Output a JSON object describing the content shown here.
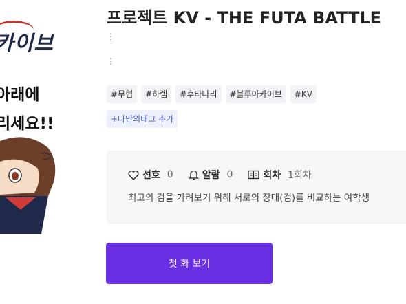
{
  "cover": {
    "logo_text": "카이브",
    "line1": "아래에",
    "line2": "리세요!!"
  },
  "work": {
    "title": "프로젝트 KV - THE FUTA BATTLE",
    "meta1": "⋮",
    "meta2": "⋮"
  },
  "tags": [
    "#무협",
    "#하렘",
    "#후타나리",
    "#블루아카이브",
    "#KV"
  ],
  "add_tag_label": "+나만의태그 추가",
  "stats": {
    "favorite_label": "선호",
    "favorite_value": "0",
    "alarm_label": "알람",
    "alarm_value": "0",
    "episodes_label": "회차",
    "episodes_value": "1회차"
  },
  "description": "최고의 검을 가려보기 위해 서로의 장대(검)를 비교하는 여학생",
  "first_episode_button": "첫 화 보기",
  "colors": {
    "accent": "#6a2fe3",
    "tag_bg": "#f2f3f6",
    "add_tag_text": "#4a5fd6"
  }
}
